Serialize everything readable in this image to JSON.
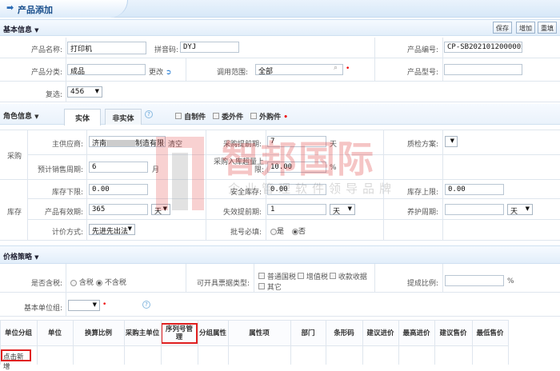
{
  "page": {
    "tab_title": "产品添加"
  },
  "basic": {
    "title": "基本信息",
    "buttons": {
      "save": "保存",
      "add": "增加",
      "reset": "重填"
    },
    "name_label": "产品名称:",
    "name_value": "打印机",
    "pinyin_label": "拼音码:",
    "pinyin_value": "DYJ",
    "code_label": "产品编号:",
    "code_value": "CP-SB2021012000002",
    "category_label": "产品分类:",
    "category_value": "成品",
    "change_link": "更改",
    "scope_label": "调用范围:",
    "scope_value": "全部",
    "model_label": "产品型号:",
    "model_value": "",
    "multi_label": "复选:",
    "multi_value": "456"
  },
  "role": {
    "title": "角色信息",
    "tabs": [
      "实体",
      "非实体"
    ],
    "checkboxes": [
      "自制件",
      "委外件",
      "外购件"
    ],
    "purchase_group": "采购",
    "stock_group": "库存",
    "supplier_label": "主供应商:",
    "supplier_value": "济南",
    "supplier_value2": "制造有限公司",
    "clear_link": "清空",
    "lead_label": "采购提前期:",
    "lead_value": "7",
    "lead_unit": "天",
    "qc_label": "质检方案:",
    "sales_cycle_label": "预计销售周期:",
    "sales_cycle_value": "6",
    "sales_cycle_unit": "月",
    "over_label": "采购入库超量上限:",
    "over_value": "10.00",
    "over_unit": "%",
    "min_label": "库存下限:",
    "min_value": "0.00",
    "safe_label": "安全库存:",
    "safe_value": "0.00",
    "max_label": "库存上限:",
    "max_value": "0.00",
    "valid_label": "产品有效期:",
    "valid_value": "365",
    "valid_unit": "天",
    "expire_label": "失效提前期:",
    "expire_value": "1",
    "expire_unit": "天",
    "maint_label": "养护周期:",
    "maint_value": "",
    "maint_unit": "天",
    "pricing_label": "计价方式:",
    "pricing_value": "先进先出法",
    "batch_label": "批号必填:",
    "batch_yes": "是",
    "batch_no": "否",
    "batch_selected": "否"
  },
  "price": {
    "title": "价格策略",
    "tax_label": "是否含税:",
    "tax_yes": "含税",
    "tax_no": "不含税",
    "tax_selected": "不含税",
    "invoice_label": "可开具票据类型:",
    "invoice_types": [
      "普通国税",
      "增值税",
      "收款收据",
      "其它"
    ],
    "commission_label": "提成比例:",
    "commission_value": "",
    "commission_unit": "%",
    "unit_group_label": "基本单位组:",
    "unit_group_value": ""
  },
  "unit_table": {
    "headers": [
      "单位分组",
      "单位",
      "换算比例",
      "采购主单位",
      "序列号管理",
      "分组属性",
      "属性项",
      "部门",
      "条形码",
      "建议进价",
      "最高进价",
      "建议售价",
      "最低售价"
    ],
    "add_link": "点击新增"
  },
  "watermark": {
    "brand": "智邦国际",
    "slogan": "企业管理软件领导品牌"
  }
}
